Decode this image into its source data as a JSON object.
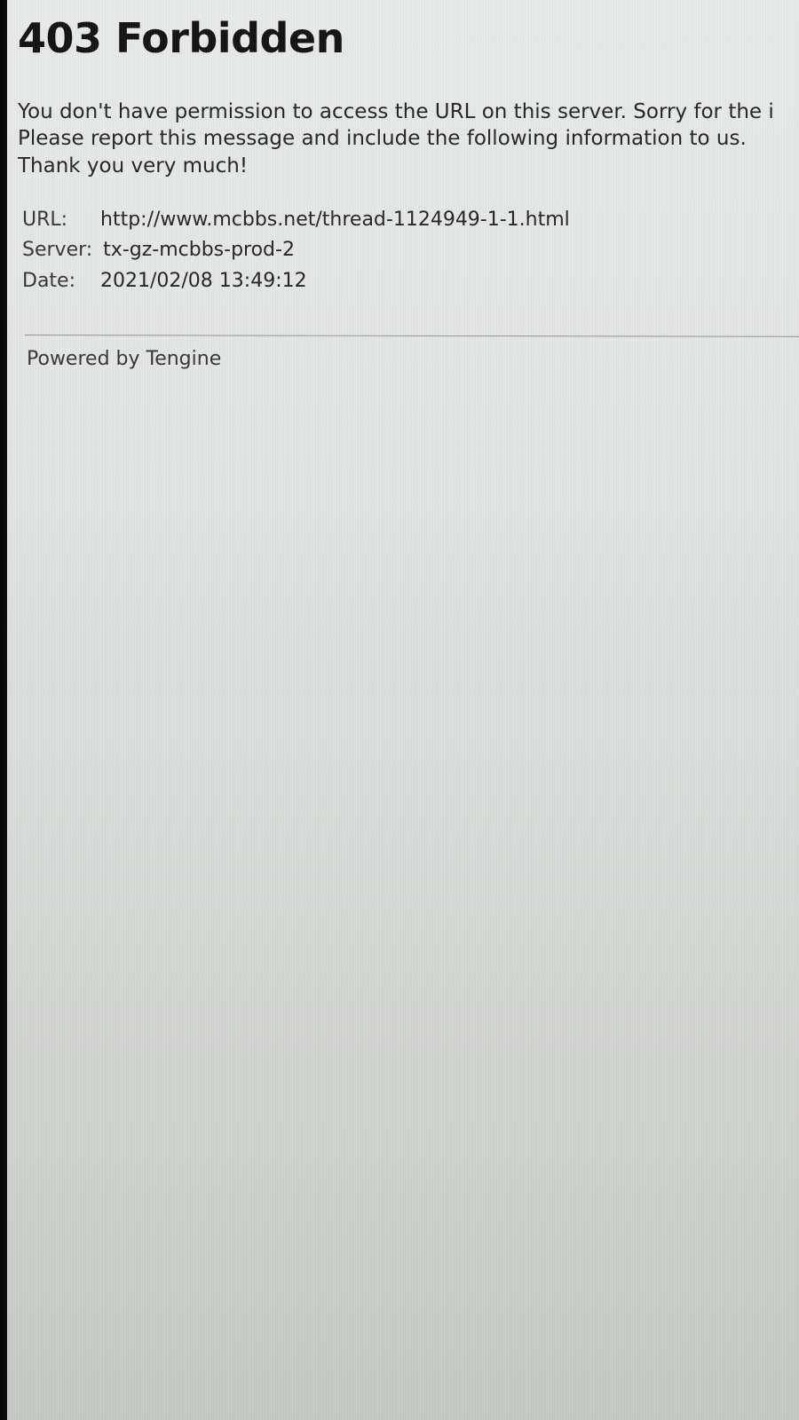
{
  "page": {
    "title": "403 Forbidden",
    "message_lines": [
      "You don't have permission to access the URL on this server. Sorry for the i",
      "Please report this message and include the following information to us.",
      "Thank you very much!"
    ],
    "details": [
      {
        "label": "URL:",
        "value": "http://www.mcbbs.net/thread-1124949-1-1.html"
      },
      {
        "label": "Server:",
        "value": "tx-gz-mcbbs-prod-2"
      },
      {
        "label": "Date:",
        "value": "2021/02/08 13:49:12"
      }
    ],
    "footer": "Powered by Tengine"
  },
  "colors": {
    "background": "#e2e4e3",
    "text": "#111111",
    "divider": "#8e918f",
    "bezel": "#050505"
  }
}
